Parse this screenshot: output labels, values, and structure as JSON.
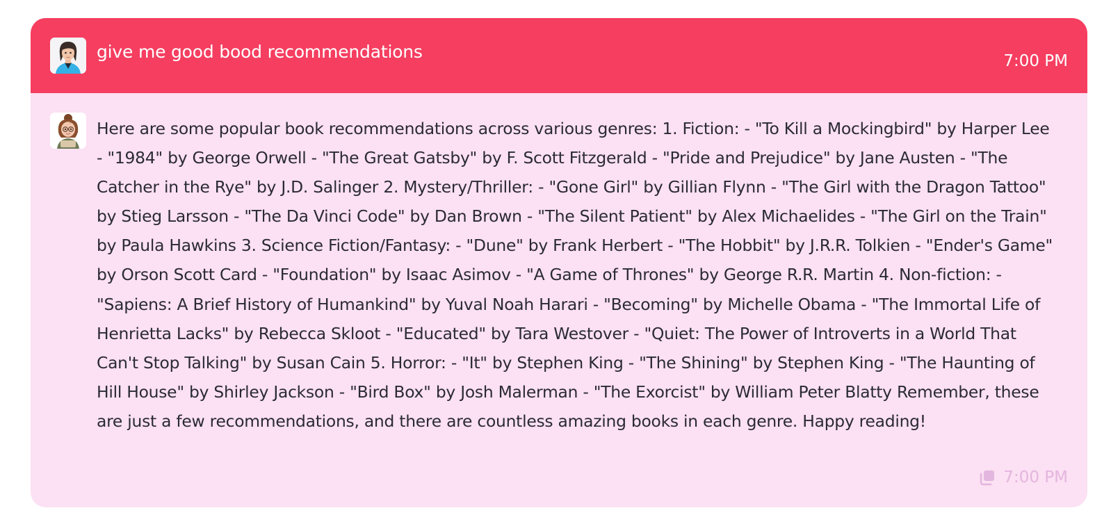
{
  "user_message": {
    "text": "give me good bood recommendations",
    "time": "7:00 PM",
    "avatar_icon": "user-avatar-icon"
  },
  "assistant_message": {
    "text": "Here are some popular book recommendations across various genres: 1. Fiction: - \"To Kill a Mockingbird\" by Harper Lee - \"1984\" by George Orwell - \"The Great Gatsby\" by F. Scott Fitzgerald - \"Pride and Prejudice\" by Jane Austen - \"The Catcher in the Rye\" by J.D. Salinger 2. Mystery/Thriller: - \"Gone Girl\" by Gillian Flynn - \"The Girl with the Dragon Tattoo\" by Stieg Larsson - \"The Da Vinci Code\" by Dan Brown - \"The Silent Patient\" by Alex Michaelides - \"The Girl on the Train\" by Paula Hawkins 3. Science Fiction/Fantasy: - \"Dune\" by Frank Herbert - \"The Hobbit\" by J.R.R. Tolkien - \"Ender's Game\" by Orson Scott Card - \"Foundation\" by Isaac Asimov - \"A Game of Thrones\" by George R.R. Martin 4. Non-fiction: - \"Sapiens: A Brief History of Humankind\" by Yuval Noah Harari - \"Becoming\" by Michelle Obama - \"The Immortal Life of Henrietta Lacks\" by Rebecca Skloot - \"Educated\" by Tara Westover - \"Quiet: The Power of Introverts in a World That Can't Stop Talking\" by Susan Cain 5. Horror: - \"It\" by Stephen King - \"The Shining\" by Stephen King - \"The Haunting of Hill House\" by Shirley Jackson - \"Bird Box\" by Josh Malerman - \"The Exorcist\" by William Peter Blatty Remember, these are just a few recommendations, and there are countless amazing books in each genre. Happy reading!",
    "time": "7:00 PM",
    "avatar_icon": "assistant-avatar-icon",
    "copy_icon": "copy-icon"
  },
  "colors": {
    "user_bubble": "#f53e60",
    "assistant_bubble": "#fce0f3",
    "assistant_text": "#2a2a35",
    "muted_time": "#e3b6de"
  }
}
